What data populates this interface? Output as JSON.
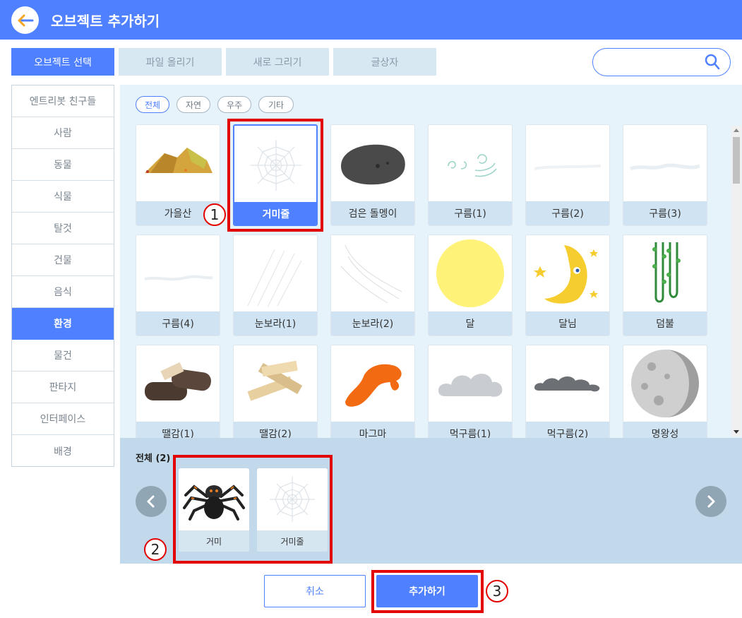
{
  "header": {
    "title": "오브젝트 추가하기",
    "back_icon": "arrow-left-icon"
  },
  "tabs": [
    {
      "label": "오브젝트 선택",
      "active": true
    },
    {
      "label": "파일 올리기",
      "active": false
    },
    {
      "label": "새로 그리기",
      "active": false
    },
    {
      "label": "글상자",
      "active": false
    }
  ],
  "search": {
    "value": "",
    "placeholder": "",
    "icon": "search-icon"
  },
  "sidebar": {
    "items": [
      {
        "label": "엔트리봇 친구들"
      },
      {
        "label": "사람"
      },
      {
        "label": "동물"
      },
      {
        "label": "식물"
      },
      {
        "label": "탈것"
      },
      {
        "label": "건물"
      },
      {
        "label": "음식"
      },
      {
        "label": "환경",
        "active": true
      },
      {
        "label": "물건"
      },
      {
        "label": "판타지"
      },
      {
        "label": "인터페이스"
      },
      {
        "label": "배경"
      }
    ]
  },
  "filters": [
    {
      "label": "전체",
      "active": true
    },
    {
      "label": "자연"
    },
    {
      "label": "우주"
    },
    {
      "label": "기타"
    }
  ],
  "objects": [
    {
      "label": "가을산",
      "icon": "autumn-mountain-icon"
    },
    {
      "label": "거미줄",
      "icon": "spider-web-icon",
      "selected": true
    },
    {
      "label": "검은 돌멩이",
      "icon": "black-stone-icon"
    },
    {
      "label": "구름(1)",
      "icon": "cloud-icon"
    },
    {
      "label": "구름(2)",
      "icon": "cloud-icon"
    },
    {
      "label": "구름(3)",
      "icon": "cloud-icon"
    },
    {
      "label": "구름(4)",
      "icon": "cloud-icon"
    },
    {
      "label": "눈보라(1)",
      "icon": "blizzard-icon"
    },
    {
      "label": "눈보라(2)",
      "icon": "blizzard-icon"
    },
    {
      "label": "달",
      "icon": "moon-icon"
    },
    {
      "label": "달님",
      "icon": "crescent-moon-face-icon"
    },
    {
      "label": "덤불",
      "icon": "vine-bush-icon"
    },
    {
      "label": "땔감(1)",
      "icon": "firewood-icon"
    },
    {
      "label": "땔감(2)",
      "icon": "firewood-icon"
    },
    {
      "label": "마그마",
      "icon": "magma-icon"
    },
    {
      "label": "먹구름(1)",
      "icon": "dark-cloud-icon"
    },
    {
      "label": "먹구름(2)",
      "icon": "dark-cloud-icon"
    },
    {
      "label": "명왕성",
      "icon": "pluto-planet-icon"
    }
  ],
  "tray": {
    "count_label": "전체 (2)",
    "items": [
      {
        "label": "거미",
        "icon": "spider-icon"
      },
      {
        "label": "거미줄",
        "icon": "spider-web-icon"
      }
    ]
  },
  "buttons": {
    "cancel": "취소",
    "add": "추가하기"
  },
  "annotations": {
    "step1": "1",
    "step2": "2",
    "step3": "3"
  },
  "colors": {
    "accent": "#4f80ff",
    "annotation": "#e30000",
    "tray_bg": "#c1d9ea",
    "panel_bg": "#e6f3fb"
  }
}
